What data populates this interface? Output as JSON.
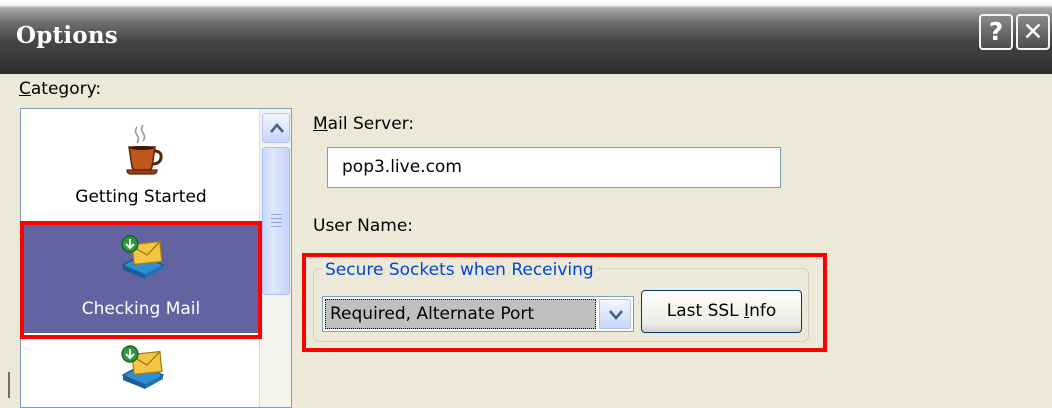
{
  "window": {
    "title": "Options",
    "help_label": "?",
    "close_label": "✕"
  },
  "category": {
    "label_prefix": "C",
    "label_rest": "ategory:",
    "items": [
      {
        "label": "Getting Started",
        "icon": "coffee-cup-icon",
        "selected": false
      },
      {
        "label": "Checking Mail",
        "icon": "mail-inbox-icon",
        "selected": true
      },
      {
        "label": "",
        "icon": "mail-inbox-icon",
        "selected": false
      }
    ]
  },
  "mail_server": {
    "label_prefix": "M",
    "label_rest": "ail Server:",
    "value": "pop3.live.com"
  },
  "user_name": {
    "label": "User Name:"
  },
  "secure_sockets": {
    "legend": "Secure Sockets when Receiving",
    "selected": "Required, Alternate Port",
    "button_prefix": "Last SSL ",
    "button_accel": "I",
    "button_rest": "nfo"
  },
  "colors": {
    "highlight": "#ff0000",
    "selected_bg": "#6164a0",
    "legend_text": "#0046d5"
  }
}
